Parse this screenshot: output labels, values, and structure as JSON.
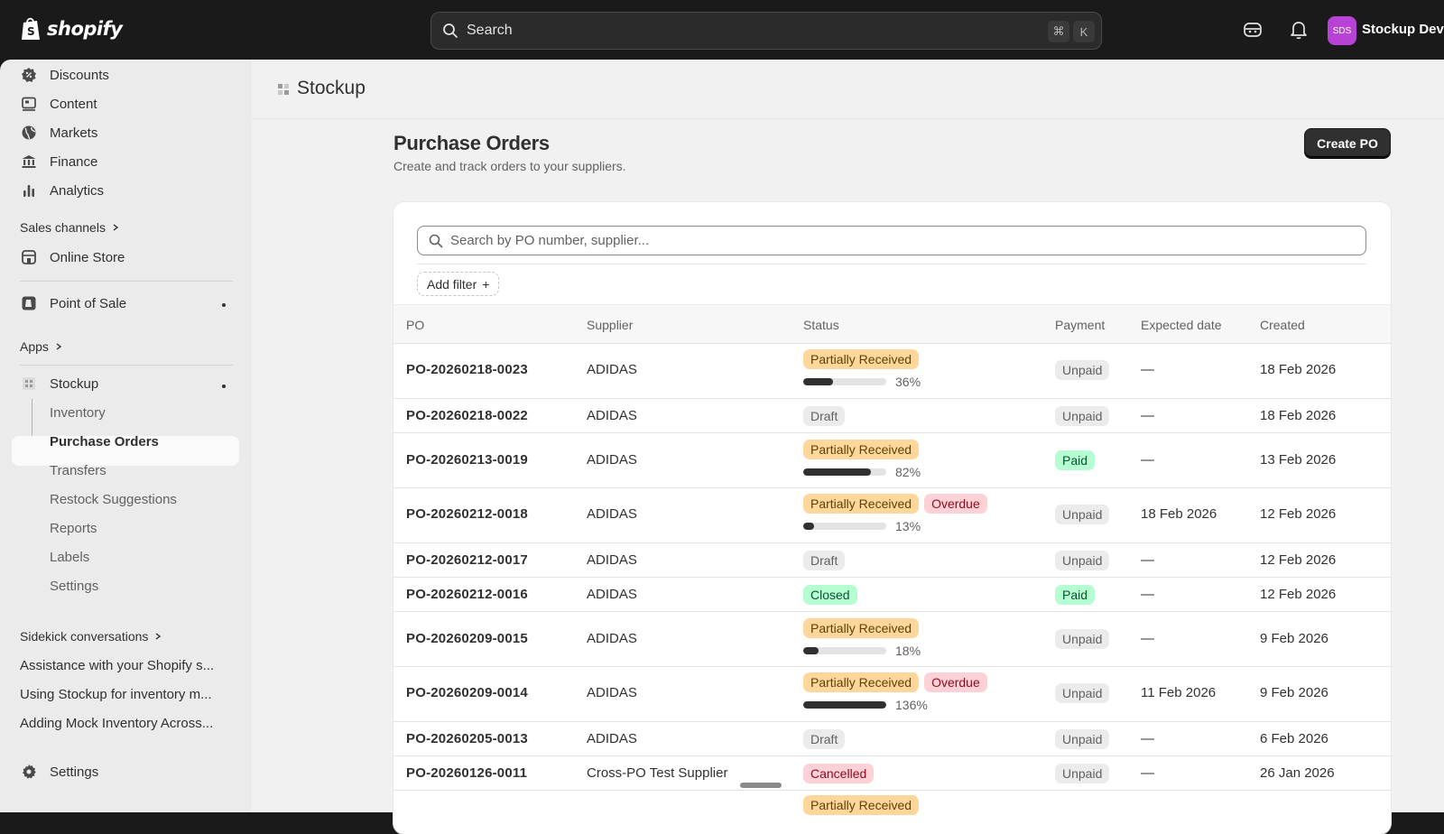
{
  "topbar": {
    "brand": "shopify",
    "search_placeholder": "Search",
    "shortcut_cmd": "⌘",
    "shortcut_key": "K",
    "avatar_initials": "SDS",
    "store_name": "Stockup Dev S"
  },
  "sidebar": {
    "items": [
      {
        "label": "Discounts",
        "icon": "discount-icon"
      },
      {
        "label": "Content",
        "icon": "content-icon"
      },
      {
        "label": "Markets",
        "icon": "globe-icon"
      },
      {
        "label": "Finance",
        "icon": "bank-icon"
      },
      {
        "label": "Analytics",
        "icon": "bar-chart-icon"
      }
    ],
    "sales_channels_label": "Sales channels",
    "online_store": "Online Store",
    "point_of_sale": "Point of Sale",
    "apps_label": "Apps",
    "stockup": "Stockup",
    "stockup_sub": [
      "Inventory",
      "Purchase Orders",
      "Transfers",
      "Restock Suggestions",
      "Reports",
      "Labels",
      "Settings"
    ],
    "sidekick_label": "Sidekick conversations",
    "conversations": [
      "Assistance with your Shopify s...",
      "Using Stockup for inventory m...",
      "Adding Mock Inventory Across..."
    ],
    "settings": "Settings"
  },
  "main": {
    "app_title": "Stockup",
    "page_title": "Purchase Orders",
    "page_subtitle": "Create and track orders to your suppliers.",
    "create_button": "Create PO",
    "filter_placeholder": "Search by PO number, supplier...",
    "add_filter": "Add filter",
    "columns": [
      "PO",
      "Supplier",
      "Status",
      "Payment",
      "Expected date",
      "Created"
    ],
    "rows": [
      {
        "po": "PO-20260218-0023",
        "supplier": "ADIDAS",
        "status": "Partially Received",
        "progress": "36%",
        "progress_value": 0.36,
        "payment": "Unpaid",
        "expected": "—",
        "created": "18 Feb 2026"
      },
      {
        "po": "PO-20260218-0022",
        "supplier": "ADIDAS",
        "status": "Draft",
        "payment": "Unpaid",
        "expected": "—",
        "created": "18 Feb 2026"
      },
      {
        "po": "PO-20260213-0019",
        "supplier": "ADIDAS",
        "status": "Partially Received",
        "progress": "82%",
        "progress_value": 0.82,
        "payment": "Paid",
        "expected": "—",
        "created": "13 Feb 2026"
      },
      {
        "po": "PO-20260212-0018",
        "supplier": "ADIDAS",
        "status": "Partially Received",
        "overdue": "Overdue",
        "progress": "13%",
        "progress_value": 0.13,
        "payment": "Unpaid",
        "expected": "18 Feb 2026",
        "created": "12 Feb 2026"
      },
      {
        "po": "PO-20260212-0017",
        "supplier": "ADIDAS",
        "status": "Draft",
        "payment": "Unpaid",
        "expected": "—",
        "created": "12 Feb 2026"
      },
      {
        "po": "PO-20260212-0016",
        "supplier": "ADIDAS",
        "status": "Closed",
        "payment": "Paid",
        "expected": "—",
        "created": "12 Feb 2026"
      },
      {
        "po": "PO-20260209-0015",
        "supplier": "ADIDAS",
        "status": "Partially Received",
        "progress": "18%",
        "progress_value": 0.18,
        "payment": "Unpaid",
        "expected": "—",
        "created": "9 Feb 2026"
      },
      {
        "po": "PO-20260209-0014",
        "supplier": "ADIDAS",
        "status": "Partially Received",
        "overdue": "Overdue",
        "progress": "136%",
        "progress_value": 1.0,
        "payment": "Unpaid",
        "expected": "11 Feb 2026",
        "created": "9 Feb 2026"
      },
      {
        "po": "PO-20260205-0013",
        "supplier": "ADIDAS",
        "status": "Draft",
        "payment": "Unpaid",
        "expected": "—",
        "created": "6 Feb 2026"
      },
      {
        "po": "PO-20260126-0011",
        "supplier": "Cross-PO Test Supplier",
        "status": "Cancelled",
        "payment": "Unpaid",
        "expected": "—",
        "created": "26 Jan 2026"
      }
    ],
    "next_row_status": "Partially Received"
  }
}
